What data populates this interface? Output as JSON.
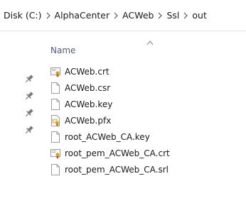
{
  "breadcrumb": [
    "Disk (C:)",
    "AlphaCenter",
    "ACWeb",
    "Ssl",
    "out"
  ],
  "column_header": "Name",
  "files": [
    {
      "name": "ACWeb.crt",
      "icon": "certificate-file-icon"
    },
    {
      "name": "ACWeb.csr",
      "icon": "blank-file-icon"
    },
    {
      "name": "ACWeb.key",
      "icon": "blank-file-icon"
    },
    {
      "name": "ACWeb.pfx",
      "icon": "pfx-file-icon"
    },
    {
      "name": "root_ACWeb_CA.key",
      "icon": "blank-file-icon"
    },
    {
      "name": "root_pem_ACWeb_CA.crt",
      "icon": "certificate-file-icon"
    },
    {
      "name": "root_pem_ACWeb_CA.srl",
      "icon": "blank-file-icon"
    }
  ],
  "colors": {
    "header_text": "#4c607a",
    "pin": "#7a7a7a",
    "cert_badge": "#d9a400"
  }
}
